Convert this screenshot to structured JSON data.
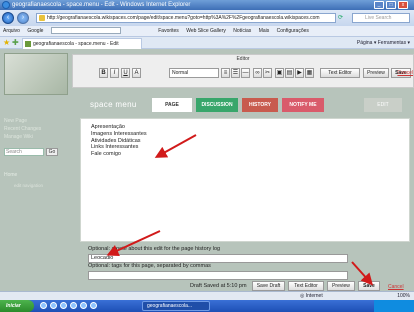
{
  "window": {
    "title": "geografianaescola - space.menu - Edit - Windows Internet Explorer"
  },
  "browser": {
    "address": "http://geografianaescola.wikispaces.com/page/edit/space.menu?goto=http%3A%2F%2Fgeografianaescola.wikispaces.com",
    "search_placeholder": "Live Search",
    "toolbar_items": [
      "Arquivo",
      "Google",
      "Favorites",
      "Web Slice Gallery",
      "Notícias",
      "Mais",
      "Configurações"
    ],
    "tab_title": "geografianaescola - space.menu - Edit",
    "command_bar": "Página ▾   Ferramentas ▾"
  },
  "editor": {
    "label": "Editor",
    "style_select": "Normal",
    "text_editor_button": "Text Editor",
    "preview_button": "Preview",
    "save_button": "Save",
    "cancel_link": "Cancel"
  },
  "wiki": {
    "space_menu_title": "space menu",
    "tabs": {
      "page": "PAGE",
      "discussion": "DISCUSSION",
      "history": "HISTORY",
      "notify": "NOTIFY ME",
      "edit": "EDIT"
    },
    "sidebar": {
      "items": [
        "New Page",
        "Recent Changes",
        "Manage Wiki"
      ],
      "search_placeholder": "Search",
      "go_label": "Go",
      "home_label": "Home",
      "home_sub": "edit navigation"
    }
  },
  "content": {
    "links": [
      "Apresentação",
      "Imagens Interessantes",
      "Atividades Didáticas",
      "Links Interessantes",
      "Fale comigo"
    ]
  },
  "form": {
    "note_label": "Optional: a note about this edit for the page history log",
    "note_value": "Leocadio",
    "tags_label": "Optional: tags for this page, separated by commas",
    "saved_status": "Draft Saved at 5:10 pm",
    "save_draft_button": "Save Draft",
    "text_editor_button": "Text Editor",
    "preview_button": "Preview",
    "save_button": "Save",
    "cancel_link": "Cancel"
  },
  "statusbar": {
    "zone": "Internet",
    "zoom": "100%"
  },
  "taskbar": {
    "start": "Iniciar",
    "task": "geografianaescola..."
  },
  "colors": {
    "page_background": "#b7c4bb",
    "discussion_tab": "#38a66b",
    "history_tab": "#c85b4e",
    "notify_tab": "#d95b6b",
    "annotation_arrow": "#d11a1a"
  }
}
